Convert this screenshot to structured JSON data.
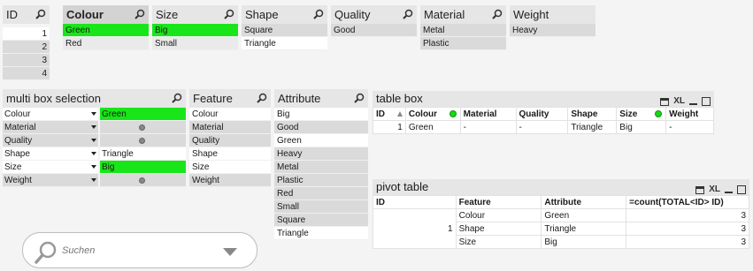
{
  "listboxes": {
    "id": {
      "title": "ID",
      "items": [
        "1",
        "2",
        "3",
        "4"
      ]
    },
    "colour": {
      "title": "Colour",
      "items": [
        "Green",
        "Red"
      ]
    },
    "size": {
      "title": "Size",
      "items": [
        "Big",
        "Small"
      ]
    },
    "shape": {
      "title": "Shape",
      "items": [
        "Square",
        "Triangle"
      ]
    },
    "quality": {
      "title": "Quality",
      "items": [
        "Good"
      ]
    },
    "material": {
      "title": "Material",
      "items": [
        "Metal",
        "Plastic"
      ]
    },
    "weight": {
      "title": "Weight",
      "items": [
        "Heavy"
      ]
    }
  },
  "multibox": {
    "title": "multi box selection",
    "rows": [
      {
        "field": "Colour",
        "value": "Green"
      },
      {
        "field": "Material",
        "value": ""
      },
      {
        "field": "Quality",
        "value": ""
      },
      {
        "field": "Shape",
        "value": "Triangle"
      },
      {
        "field": "Size",
        "value": "Big"
      },
      {
        "field": "Weight",
        "value": ""
      }
    ]
  },
  "feature": {
    "title": "Feature",
    "items": [
      "Colour",
      "Material",
      "Quality",
      "Shape",
      "Size",
      "Weight"
    ]
  },
  "attribute": {
    "title": "Attribute",
    "items": [
      "Big",
      "Good",
      "Green",
      "Heavy",
      "Metal",
      "Plastic",
      "Red",
      "Small",
      "Square",
      "Triangle"
    ]
  },
  "tablebox": {
    "title": "table box",
    "xl_label": "XL",
    "headers": [
      "ID",
      "Colour",
      "Material",
      "Quality",
      "Shape",
      "Size",
      "Weight"
    ],
    "rows": [
      [
        "1",
        "Green",
        "-",
        "-",
        "Triangle",
        "Big",
        "-"
      ]
    ]
  },
  "pivot": {
    "title": "pivot table",
    "xl_label": "XL",
    "headers": [
      "ID",
      "Feature",
      "Attribute",
      "=count(TOTAL<ID> ID)"
    ],
    "id_value": "1",
    "rows": [
      {
        "feature": "Colour",
        "attribute": "Green",
        "count": "3"
      },
      {
        "feature": "Shape",
        "attribute": "Triangle",
        "count": "3"
      },
      {
        "feature": "Size",
        "attribute": "Big",
        "count": "3"
      }
    ]
  },
  "search": {
    "placeholder": "Suchen"
  },
  "colors": {
    "selected": "#19e619",
    "excluded": "#dadada",
    "caption": "#e6e6e6"
  }
}
